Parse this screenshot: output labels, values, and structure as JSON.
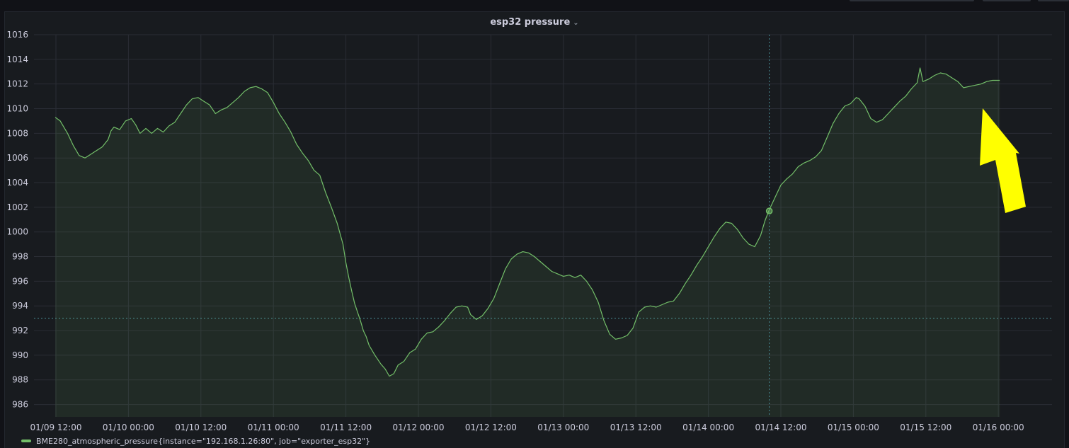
{
  "panel": {
    "title": "esp32 pressure",
    "menu_icon": "chevron-down-icon"
  },
  "colors": {
    "series": "#73bf69",
    "background": "#181b1f",
    "grid": "#2a2d35",
    "crosshair": "#4a8c96",
    "annotation_arrow": "#ffff00"
  },
  "legend": {
    "label": "BME280_atmospheric_pressure{instance=\"192.168.1.26:80\", job=\"exporter_esp32\"}"
  },
  "chart_data": {
    "type": "area",
    "title": "esp32 pressure",
    "xlabel": "",
    "ylabel": "",
    "ylim": [
      985,
      1016
    ],
    "xlim": [
      0,
      7.78
    ],
    "x_unit": "days since 01/09 12:00",
    "x_ticks": [
      {
        "t": 0,
        "label": "01/09 12:00"
      },
      {
        "t": 0.5,
        "label": "01/10 00:00"
      },
      {
        "t": 1.0,
        "label": "01/10 12:00"
      },
      {
        "t": 1.5,
        "label": "01/11 00:00"
      },
      {
        "t": 2.0,
        "label": "01/11 12:00"
      },
      {
        "t": 2.5,
        "label": "01/12 00:00"
      },
      {
        "t": 3.0,
        "label": "01/12 12:00"
      },
      {
        "t": 3.5,
        "label": "01/13 00:00"
      },
      {
        "t": 4.0,
        "label": "01/13 12:00"
      },
      {
        "t": 4.5,
        "label": "01/14 00:00"
      },
      {
        "t": 5.0,
        "label": "01/14 12:00"
      },
      {
        "t": 5.5,
        "label": "01/15 00:00"
      },
      {
        "t": 6.0,
        "label": "01/15 12:00"
      },
      {
        "t": 6.5,
        "label": "01/16 00:00"
      }
    ],
    "y_ticks": [
      986,
      988,
      990,
      992,
      994,
      996,
      998,
      1000,
      1002,
      1004,
      1006,
      1008,
      1010,
      1012,
      1014,
      1016
    ],
    "grid": true,
    "legend_position": "bottom-left",
    "series": [
      {
        "name": "BME280_atmospheric_pressure{instance=\"192.168.1.26:80\", job=\"exporter_esp32\"}",
        "points": [
          [
            -0.005,
            1009.3
          ],
          [
            0.03,
            1009.0
          ],
          [
            0.08,
            1008.0
          ],
          [
            0.12,
            1007.0
          ],
          [
            0.16,
            1006.2
          ],
          [
            0.2,
            1006.0
          ],
          [
            0.24,
            1006.3
          ],
          [
            0.28,
            1006.6
          ],
          [
            0.32,
            1006.9
          ],
          [
            0.36,
            1007.5
          ],
          [
            0.38,
            1008.2
          ],
          [
            0.4,
            1008.5
          ],
          [
            0.44,
            1008.3
          ],
          [
            0.48,
            1009.0
          ],
          [
            0.52,
            1009.2
          ],
          [
            0.55,
            1008.7
          ],
          [
            0.58,
            1008.0
          ],
          [
            0.62,
            1008.4
          ],
          [
            0.66,
            1008.0
          ],
          [
            0.7,
            1008.4
          ],
          [
            0.74,
            1008.1
          ],
          [
            0.78,
            1008.6
          ],
          [
            0.82,
            1008.9
          ],
          [
            0.86,
            1009.6
          ],
          [
            0.9,
            1010.3
          ],
          [
            0.94,
            1010.8
          ],
          [
            0.98,
            1010.9
          ],
          [
            1.02,
            1010.6
          ],
          [
            1.06,
            1010.3
          ],
          [
            1.1,
            1009.6
          ],
          [
            1.14,
            1009.9
          ],
          [
            1.18,
            1010.1
          ],
          [
            1.22,
            1010.5
          ],
          [
            1.26,
            1010.9
          ],
          [
            1.3,
            1011.4
          ],
          [
            1.34,
            1011.7
          ],
          [
            1.38,
            1011.8
          ],
          [
            1.42,
            1011.6
          ],
          [
            1.46,
            1011.3
          ],
          [
            1.5,
            1010.5
          ],
          [
            1.54,
            1009.6
          ],
          [
            1.58,
            1008.9
          ],
          [
            1.62,
            1008.1
          ],
          [
            1.66,
            1007.1
          ],
          [
            1.7,
            1006.4
          ],
          [
            1.74,
            1005.8
          ],
          [
            1.78,
            1005.0
          ],
          [
            1.82,
            1004.6
          ],
          [
            1.86,
            1003.2
          ],
          [
            1.9,
            1002.0
          ],
          [
            1.94,
            1000.7
          ],
          [
            1.98,
            999.0
          ],
          [
            2.0,
            997.5
          ],
          [
            2.02,
            996.3
          ],
          [
            2.04,
            995.2
          ],
          [
            2.06,
            994.2
          ],
          [
            2.08,
            993.5
          ],
          [
            2.1,
            992.8
          ],
          [
            2.12,
            992.0
          ],
          [
            2.14,
            991.5
          ],
          [
            2.16,
            990.8
          ],
          [
            2.2,
            990.0
          ],
          [
            2.24,
            989.3
          ],
          [
            2.27,
            988.9
          ],
          [
            2.3,
            988.3
          ],
          [
            2.33,
            988.5
          ],
          [
            2.36,
            989.2
          ],
          [
            2.4,
            989.5
          ],
          [
            2.44,
            990.2
          ],
          [
            2.48,
            990.5
          ],
          [
            2.52,
            991.3
          ],
          [
            2.56,
            991.8
          ],
          [
            2.6,
            991.9
          ],
          [
            2.64,
            992.3
          ],
          [
            2.68,
            992.8
          ],
          [
            2.72,
            993.4
          ],
          [
            2.76,
            993.9
          ],
          [
            2.8,
            994.0
          ],
          [
            2.84,
            993.9
          ],
          [
            2.86,
            993.3
          ],
          [
            2.9,
            992.9
          ],
          [
            2.94,
            993.2
          ],
          [
            2.98,
            993.8
          ],
          [
            3.02,
            994.6
          ],
          [
            3.06,
            995.8
          ],
          [
            3.1,
            997.0
          ],
          [
            3.14,
            997.8
          ],
          [
            3.18,
            998.2
          ],
          [
            3.22,
            998.4
          ],
          [
            3.26,
            998.3
          ],
          [
            3.3,
            998.0
          ],
          [
            3.34,
            997.6
          ],
          [
            3.38,
            997.2
          ],
          [
            3.42,
            996.8
          ],
          [
            3.46,
            996.6
          ],
          [
            3.5,
            996.4
          ],
          [
            3.54,
            996.5
          ],
          [
            3.58,
            996.3
          ],
          [
            3.62,
            996.5
          ],
          [
            3.66,
            996.0
          ],
          [
            3.7,
            995.3
          ],
          [
            3.74,
            994.3
          ],
          [
            3.78,
            992.8
          ],
          [
            3.82,
            991.7
          ],
          [
            3.86,
            991.3
          ],
          [
            3.9,
            991.4
          ],
          [
            3.94,
            991.6
          ],
          [
            3.98,
            992.2
          ],
          [
            4.02,
            993.5
          ],
          [
            4.06,
            993.9
          ],
          [
            4.1,
            994.0
          ],
          [
            4.14,
            993.9
          ],
          [
            4.18,
            994.1
          ],
          [
            4.22,
            994.3
          ],
          [
            4.26,
            994.4
          ],
          [
            4.3,
            995.0
          ],
          [
            4.34,
            995.8
          ],
          [
            4.38,
            996.5
          ],
          [
            4.42,
            997.3
          ],
          [
            4.46,
            998.0
          ],
          [
            4.5,
            998.8
          ],
          [
            4.54,
            999.6
          ],
          [
            4.58,
            1000.3
          ],
          [
            4.62,
            1000.8
          ],
          [
            4.66,
            1000.7
          ],
          [
            4.7,
            1000.2
          ],
          [
            4.74,
            999.5
          ],
          [
            4.78,
            999.0
          ],
          [
            4.82,
            998.8
          ],
          [
            4.86,
            999.7
          ],
          [
            4.89,
            1000.9
          ],
          [
            4.92,
            1001.8
          ],
          [
            4.96,
            1002.8
          ],
          [
            5.0,
            1003.8
          ],
          [
            5.04,
            1004.3
          ],
          [
            5.08,
            1004.7
          ],
          [
            5.12,
            1005.3
          ],
          [
            5.16,
            1005.6
          ],
          [
            5.2,
            1005.8
          ],
          [
            5.24,
            1006.1
          ],
          [
            5.28,
            1006.6
          ],
          [
            5.32,
            1007.7
          ],
          [
            5.36,
            1008.8
          ],
          [
            5.4,
            1009.6
          ],
          [
            5.44,
            1010.2
          ],
          [
            5.48,
            1010.4
          ],
          [
            5.52,
            1010.9
          ],
          [
            5.54,
            1010.8
          ],
          [
            5.58,
            1010.2
          ],
          [
            5.62,
            1009.2
          ],
          [
            5.66,
            1008.9
          ],
          [
            5.7,
            1009.1
          ],
          [
            5.74,
            1009.6
          ],
          [
            5.78,
            1010.1
          ],
          [
            5.82,
            1010.6
          ],
          [
            5.86,
            1011.0
          ],
          [
            5.9,
            1011.6
          ],
          [
            5.94,
            1012.1
          ],
          [
            5.96,
            1013.3
          ],
          [
            5.98,
            1012.2
          ],
          [
            6.02,
            1012.4
          ],
          [
            6.06,
            1012.7
          ],
          [
            6.1,
            1012.9
          ],
          [
            6.14,
            1012.8
          ],
          [
            6.18,
            1012.5
          ],
          [
            6.22,
            1012.2
          ],
          [
            6.26,
            1011.7
          ],
          [
            6.3,
            1011.8
          ],
          [
            6.34,
            1011.9
          ],
          [
            6.38,
            1012.0
          ],
          [
            6.42,
            1012.2
          ],
          [
            6.46,
            1012.3
          ],
          [
            6.51,
            1012.3
          ]
        ]
      }
    ],
    "hover_crosshair": {
      "t": 4.92,
      "value": 1001.7
    },
    "threshold_line": 993
  }
}
